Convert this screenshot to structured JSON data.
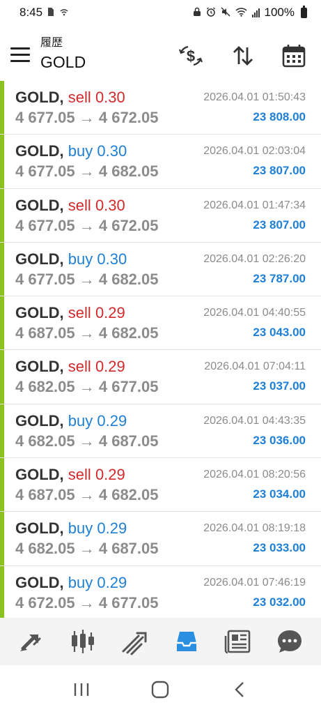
{
  "status_bar": {
    "time": "8:45",
    "battery": "100%"
  },
  "header": {
    "subtitle": "履歴",
    "title": "GOLD"
  },
  "trades": [
    {
      "symbol": "GOLD,",
      "side": "sell",
      "volume": "0.30",
      "prices": "4 677.05 → 4 672.05",
      "time": "2026.04.01 01:50:43",
      "profit": "23 808.00"
    },
    {
      "symbol": "GOLD,",
      "side": "buy",
      "volume": "0.30",
      "prices": "4 677.05 → 4 682.05",
      "time": "2026.04.01 02:03:04",
      "profit": "23 807.00"
    },
    {
      "symbol": "GOLD,",
      "side": "sell",
      "volume": "0.30",
      "prices": "4 677.05 → 4 672.05",
      "time": "2026.04.01 01:47:34",
      "profit": "23 807.00"
    },
    {
      "symbol": "GOLD,",
      "side": "buy",
      "volume": "0.30",
      "prices": "4 677.05 → 4 682.05",
      "time": "2026.04.01 02:26:20",
      "profit": "23 787.00"
    },
    {
      "symbol": "GOLD,",
      "side": "sell",
      "volume": "0.29",
      "prices": "4 687.05 → 4 682.05",
      "time": "2026.04.01 04:40:55",
      "profit": "23 043.00"
    },
    {
      "symbol": "GOLD,",
      "side": "sell",
      "volume": "0.29",
      "prices": "4 682.05 → 4 677.05",
      "time": "2026.04.01 07:04:11",
      "profit": "23 037.00"
    },
    {
      "symbol": "GOLD,",
      "side": "buy",
      "volume": "0.29",
      "prices": "4 682.05 → 4 687.05",
      "time": "2026.04.01 04:43:35",
      "profit": "23 036.00"
    },
    {
      "symbol": "GOLD,",
      "side": "sell",
      "volume": "0.29",
      "prices": "4 687.05 → 4 682.05",
      "time": "2026.04.01 08:20:56",
      "profit": "23 034.00"
    },
    {
      "symbol": "GOLD,",
      "side": "buy",
      "volume": "0.29",
      "prices": "4 682.05 → 4 687.05",
      "time": "2026.04.01 08:19:18",
      "profit": "23 033.00"
    },
    {
      "symbol": "GOLD,",
      "side": "buy",
      "volume": "0.29",
      "prices": "4 672.05 → 4 677.05",
      "time": "2026.04.01 07:46:19",
      "profit": "23 032.00"
    }
  ],
  "colors": {
    "accent": "#8cc21f",
    "sell": "#d12a2a",
    "buy": "#1e7fd6",
    "active_nav": "#2a8fe0"
  },
  "bottom_nav": [
    {
      "icon": "trade-arrows-icon"
    },
    {
      "icon": "candlestick-chart-icon"
    },
    {
      "icon": "trade-lines-icon"
    },
    {
      "icon": "inbox-history-icon",
      "active": true
    },
    {
      "icon": "news-icon"
    },
    {
      "icon": "chat-icon"
    }
  ]
}
